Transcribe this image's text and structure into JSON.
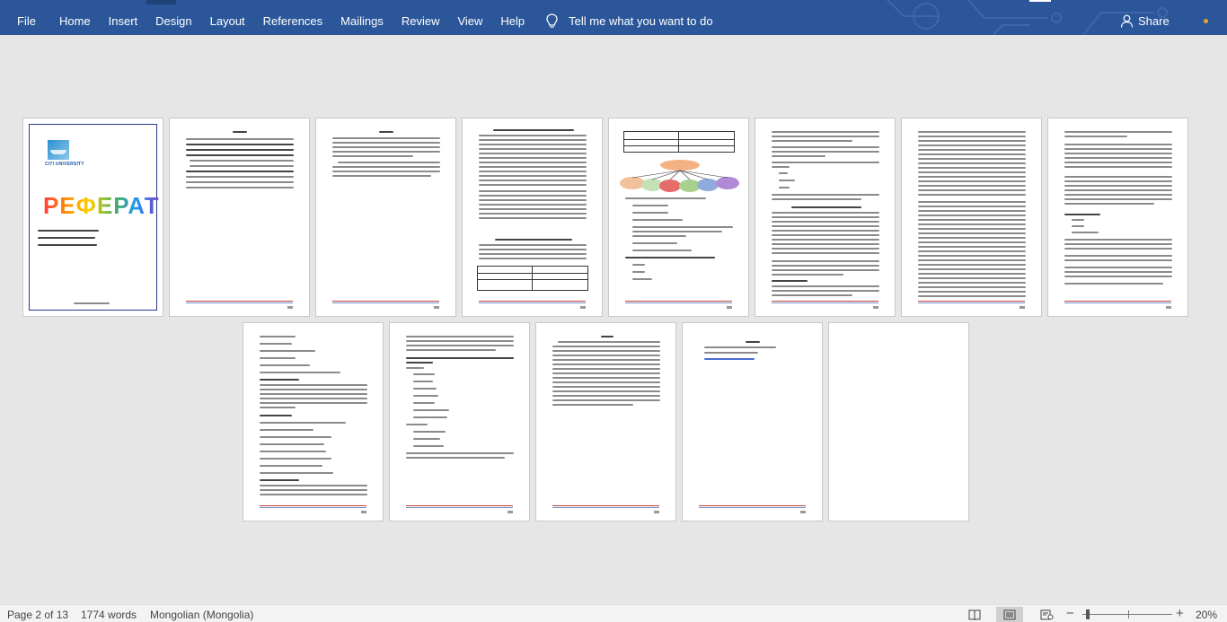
{
  "ribbon": {
    "menu": [
      {
        "name": "menu-file",
        "label": "File"
      },
      {
        "name": "menu-home",
        "label": "Home"
      },
      {
        "name": "menu-insert",
        "label": "Insert"
      },
      {
        "name": "menu-design",
        "label": "Design"
      },
      {
        "name": "menu-layout",
        "label": "Layout"
      },
      {
        "name": "menu-references",
        "label": "References"
      },
      {
        "name": "menu-mailings",
        "label": "Mailings"
      },
      {
        "name": "menu-review",
        "label": "Review"
      },
      {
        "name": "menu-view",
        "label": "View"
      },
      {
        "name": "menu-help",
        "label": "Help"
      }
    ],
    "tell_me": "Tell me what you want to do",
    "tell_me_icon": "lightbulb-icon",
    "share": "Share",
    "share_icon": "person-icon",
    "accent_color": "#2b579a"
  },
  "cover": {
    "logo_text": "CITI UNIVERSITY",
    "title": "РЕФЕРАТ"
  },
  "status": {
    "page": "Page 2 of 13",
    "words": "1774 words",
    "language": "Mongolian (Mongolia)",
    "zoom": "20%",
    "zoom_minus": "−",
    "zoom_plus": "+",
    "zoom_level": 0.2
  }
}
